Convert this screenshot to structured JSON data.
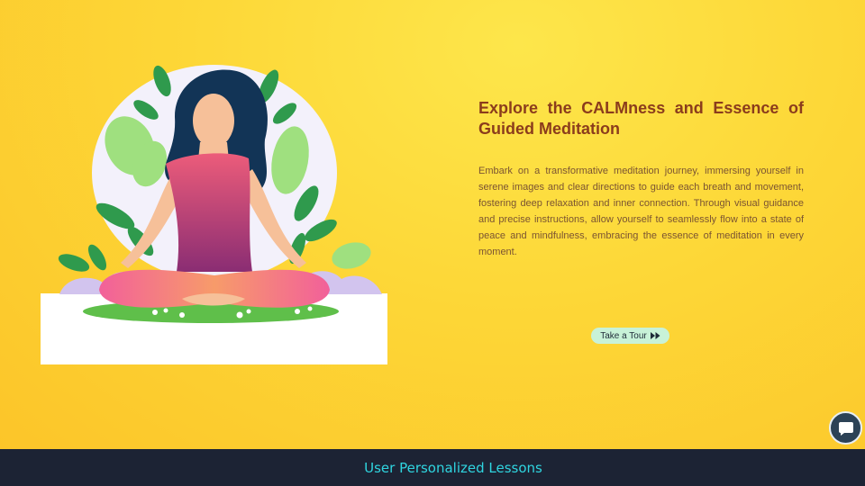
{
  "hero": {
    "heading": "Explore the CALMness and Essence of Guided Meditation",
    "paragraph": "Embark on a transformative meditation journey, immersing yourself in serene images and clear directions to guide each breath and movement, fostering deep relaxation and inner connection. Through visual guidance and precise instructions, allow yourself to seamlessly flow into a state of peace and mindfulness, embracing the essence of meditation in every moment.",
    "cta_label": "Take a Tour",
    "cta_icon": "fast-forward-icon",
    "illustration": "meditation-illustration"
  },
  "chat": {
    "icon": "chat-bubble-icon"
  },
  "footer": {
    "label": "User Personalized Lessons"
  },
  "colors": {
    "background": "#fcd43a",
    "heading": "#8b3c1c",
    "paragraph": "#7b5432",
    "cta_bg": "#c8f2d8",
    "footer_bg": "#1c2334",
    "footer_text": "#2fd5e0",
    "chat_bg": "#2c4256"
  }
}
